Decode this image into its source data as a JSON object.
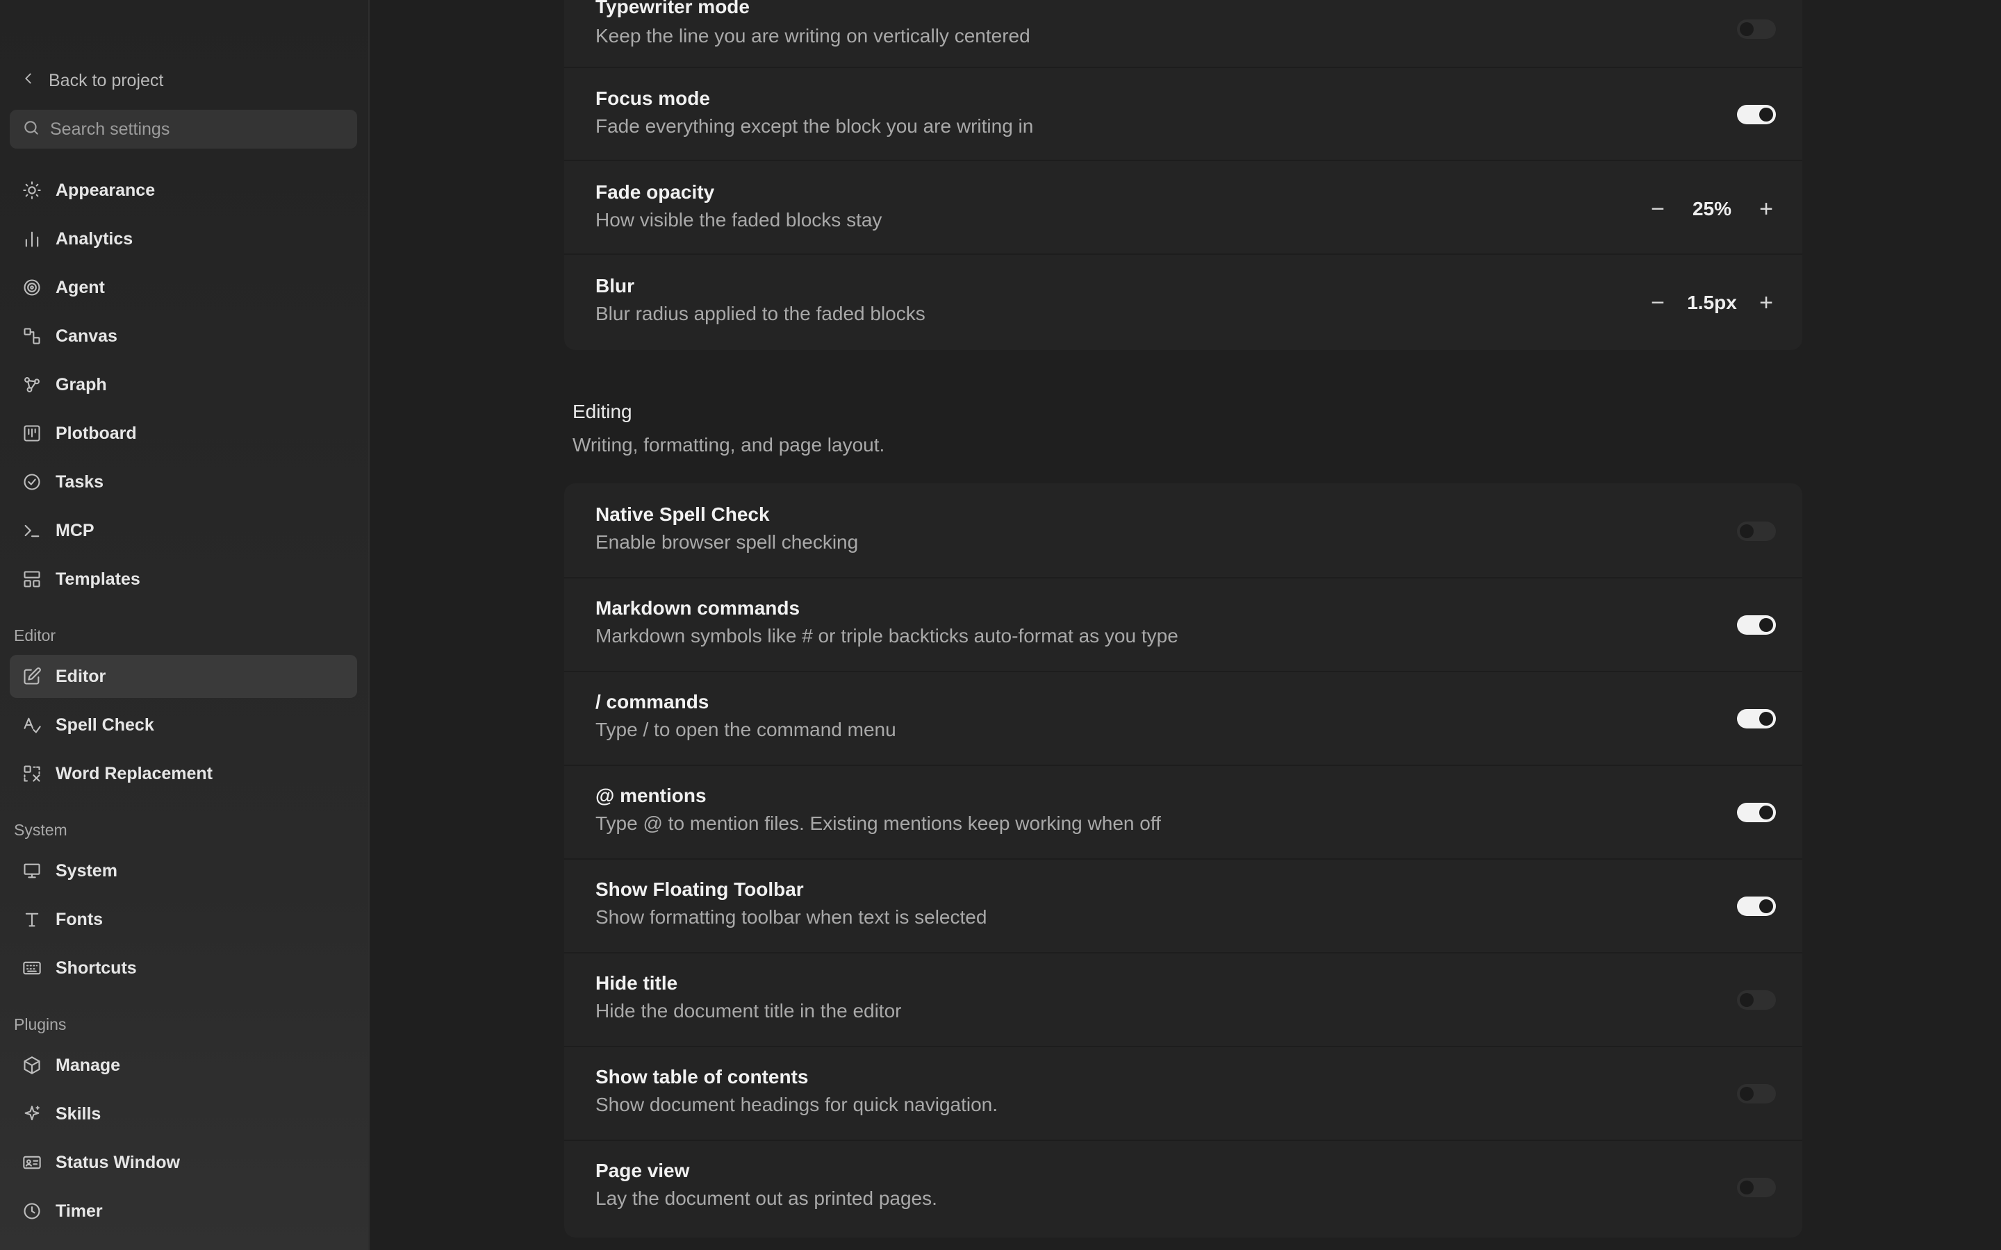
{
  "sidebar": {
    "back_label": "Back to project",
    "search_placeholder": "Search settings",
    "items": [
      {
        "label": "Appearance",
        "icon": "sun-icon"
      },
      {
        "label": "Analytics",
        "icon": "bar-chart-icon"
      },
      {
        "label": "Agent",
        "icon": "spiral-icon"
      },
      {
        "label": "Canvas",
        "icon": "canvas-icon"
      },
      {
        "label": "Graph",
        "icon": "graph-icon"
      },
      {
        "label": "Plotboard",
        "icon": "board-icon"
      },
      {
        "label": "Tasks",
        "icon": "check-circle-icon"
      },
      {
        "label": "MCP",
        "icon": "terminal-icon"
      },
      {
        "label": "Templates",
        "icon": "layout-icon"
      }
    ],
    "groups": {
      "editor": {
        "label": "Editor",
        "items": [
          {
            "label": "Editor",
            "icon": "edit-icon",
            "active": true
          },
          {
            "label": "Spell Check",
            "icon": "spell-check-icon"
          },
          {
            "label": "Word Replacement",
            "icon": "replace-icon"
          }
        ]
      },
      "system": {
        "label": "System",
        "items": [
          {
            "label": "System",
            "icon": "monitor-icon"
          },
          {
            "label": "Fonts",
            "icon": "type-icon"
          },
          {
            "label": "Shortcuts",
            "icon": "keyboard-icon"
          }
        ]
      },
      "plugins": {
        "label": "Plugins",
        "items": [
          {
            "label": "Manage",
            "icon": "package-icon"
          },
          {
            "label": "Skills",
            "icon": "sparkle-icon"
          },
          {
            "label": "Status Window",
            "icon": "id-card-icon"
          },
          {
            "label": "Timer",
            "icon": "clock-icon"
          }
        ]
      }
    }
  },
  "focus_section": {
    "rows": [
      {
        "title": "Typewriter mode",
        "desc": "Keep the line you are writing on vertically centered",
        "on": false
      },
      {
        "title": "Focus mode",
        "desc": "Fade everything except the block you are writing in",
        "on": true
      },
      {
        "title": "Fade opacity",
        "desc": "How visible the faded blocks stay",
        "value": "25%"
      },
      {
        "title": "Blur",
        "desc": "Blur radius applied to the faded blocks",
        "value": "1.5px"
      }
    ]
  },
  "editing_section": {
    "title": "Editing",
    "desc": "Writing, formatting, and page layout.",
    "rows": [
      {
        "title": "Native Spell Check",
        "desc": "Enable browser spell checking",
        "on": false
      },
      {
        "title": "Markdown commands",
        "desc": "Markdown symbols like # or triple backticks auto-format as you type",
        "on": true
      },
      {
        "title": "/ commands",
        "desc": "Type / to open the command menu",
        "on": true
      },
      {
        "title": "@ mentions",
        "desc": "Type @ to mention files. Existing mentions keep working when off",
        "on": true
      },
      {
        "title": "Show Floating Toolbar",
        "desc": "Show formatting toolbar when text is selected",
        "on": true
      },
      {
        "title": "Hide title",
        "desc": "Hide the document title in the editor",
        "on": false
      },
      {
        "title": "Show table of contents",
        "desc": "Show document headings for quick navigation.",
        "on": false
      },
      {
        "title": "Page view",
        "desc": "Lay the document out as printed pages.",
        "on": false
      }
    ]
  },
  "stepper": {
    "minus": "−",
    "plus": "+"
  }
}
